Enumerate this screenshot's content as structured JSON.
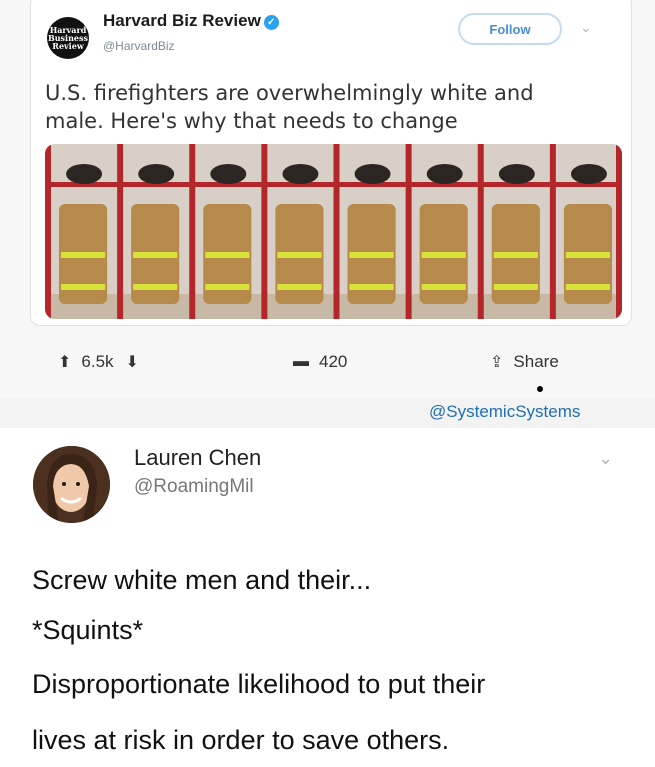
{
  "embedded_tweet": {
    "logo_lines": [
      "Harvard",
      "Business",
      "Review"
    ],
    "account_name": "Harvard Biz Review",
    "verified_icon": "verified-badge-icon",
    "handle": "@HarvardBiz",
    "follow_label": "Follow",
    "text_line1": "U.S. firefighters are overwhelmingly white and",
    "text_line2": "male. Here's why that needs to change",
    "image_subject": "firefighter gear lockers"
  },
  "actions": {
    "upvotes": "6.5k",
    "comments": "420",
    "share_label": "Share"
  },
  "watermark": "@SystemicSystems",
  "tweet": {
    "author": "Lauren Chen",
    "handle": "@RoamingMil",
    "lines": [
      "Screw white men and their...",
      "*Squints*",
      "Disproportionate likelihood to put their",
      "lives at risk in order to save others."
    ]
  },
  "colors": {
    "accent_blue": "#1f6fb3",
    "verified_blue": "#2aa0f0",
    "locker_red": "#b3262a",
    "jacket_tan": "#b58a4a",
    "reflective_yellow": "#d8e23a"
  }
}
